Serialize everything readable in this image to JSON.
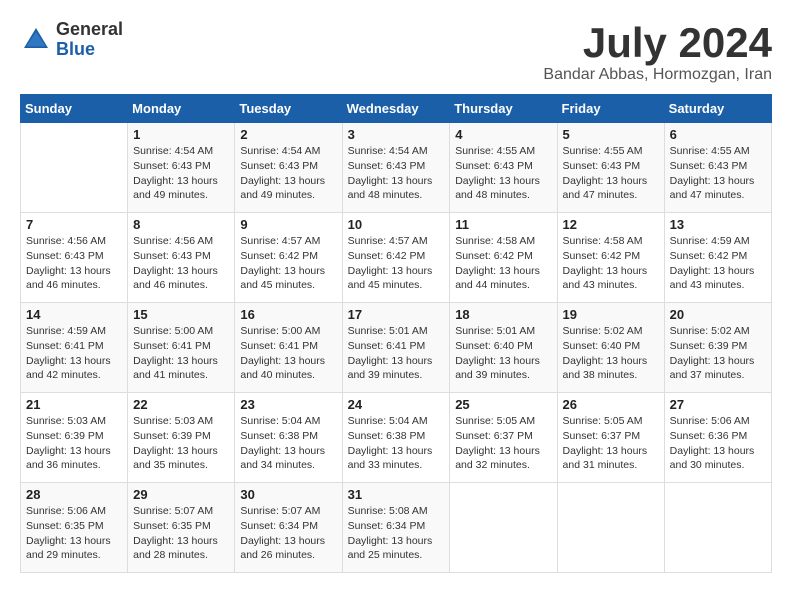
{
  "logo": {
    "general": "General",
    "blue": "Blue"
  },
  "title": "July 2024",
  "subtitle": "Bandar Abbas, Hormozgan, Iran",
  "calendar": {
    "headers": [
      "Sunday",
      "Monday",
      "Tuesday",
      "Wednesday",
      "Thursday",
      "Friday",
      "Saturday"
    ],
    "rows": [
      [
        {
          "day": "",
          "info": ""
        },
        {
          "day": "1",
          "info": "Sunrise: 4:54 AM\nSunset: 6:43 PM\nDaylight: 13 hours\nand 49 minutes."
        },
        {
          "day": "2",
          "info": "Sunrise: 4:54 AM\nSunset: 6:43 PM\nDaylight: 13 hours\nand 49 minutes."
        },
        {
          "day": "3",
          "info": "Sunrise: 4:54 AM\nSunset: 6:43 PM\nDaylight: 13 hours\nand 48 minutes."
        },
        {
          "day": "4",
          "info": "Sunrise: 4:55 AM\nSunset: 6:43 PM\nDaylight: 13 hours\nand 48 minutes."
        },
        {
          "day": "5",
          "info": "Sunrise: 4:55 AM\nSunset: 6:43 PM\nDaylight: 13 hours\nand 47 minutes."
        },
        {
          "day": "6",
          "info": "Sunrise: 4:55 AM\nSunset: 6:43 PM\nDaylight: 13 hours\nand 47 minutes."
        }
      ],
      [
        {
          "day": "7",
          "info": "Sunrise: 4:56 AM\nSunset: 6:43 PM\nDaylight: 13 hours\nand 46 minutes."
        },
        {
          "day": "8",
          "info": "Sunrise: 4:56 AM\nSunset: 6:43 PM\nDaylight: 13 hours\nand 46 minutes."
        },
        {
          "day": "9",
          "info": "Sunrise: 4:57 AM\nSunset: 6:42 PM\nDaylight: 13 hours\nand 45 minutes."
        },
        {
          "day": "10",
          "info": "Sunrise: 4:57 AM\nSunset: 6:42 PM\nDaylight: 13 hours\nand 45 minutes."
        },
        {
          "day": "11",
          "info": "Sunrise: 4:58 AM\nSunset: 6:42 PM\nDaylight: 13 hours\nand 44 minutes."
        },
        {
          "day": "12",
          "info": "Sunrise: 4:58 AM\nSunset: 6:42 PM\nDaylight: 13 hours\nand 43 minutes."
        },
        {
          "day": "13",
          "info": "Sunrise: 4:59 AM\nSunset: 6:42 PM\nDaylight: 13 hours\nand 43 minutes."
        }
      ],
      [
        {
          "day": "14",
          "info": "Sunrise: 4:59 AM\nSunset: 6:41 PM\nDaylight: 13 hours\nand 42 minutes."
        },
        {
          "day": "15",
          "info": "Sunrise: 5:00 AM\nSunset: 6:41 PM\nDaylight: 13 hours\nand 41 minutes."
        },
        {
          "day": "16",
          "info": "Sunrise: 5:00 AM\nSunset: 6:41 PM\nDaylight: 13 hours\nand 40 minutes."
        },
        {
          "day": "17",
          "info": "Sunrise: 5:01 AM\nSunset: 6:41 PM\nDaylight: 13 hours\nand 39 minutes."
        },
        {
          "day": "18",
          "info": "Sunrise: 5:01 AM\nSunset: 6:40 PM\nDaylight: 13 hours\nand 39 minutes."
        },
        {
          "day": "19",
          "info": "Sunrise: 5:02 AM\nSunset: 6:40 PM\nDaylight: 13 hours\nand 38 minutes."
        },
        {
          "day": "20",
          "info": "Sunrise: 5:02 AM\nSunset: 6:39 PM\nDaylight: 13 hours\nand 37 minutes."
        }
      ],
      [
        {
          "day": "21",
          "info": "Sunrise: 5:03 AM\nSunset: 6:39 PM\nDaylight: 13 hours\nand 36 minutes."
        },
        {
          "day": "22",
          "info": "Sunrise: 5:03 AM\nSunset: 6:39 PM\nDaylight: 13 hours\nand 35 minutes."
        },
        {
          "day": "23",
          "info": "Sunrise: 5:04 AM\nSunset: 6:38 PM\nDaylight: 13 hours\nand 34 minutes."
        },
        {
          "day": "24",
          "info": "Sunrise: 5:04 AM\nSunset: 6:38 PM\nDaylight: 13 hours\nand 33 minutes."
        },
        {
          "day": "25",
          "info": "Sunrise: 5:05 AM\nSunset: 6:37 PM\nDaylight: 13 hours\nand 32 minutes."
        },
        {
          "day": "26",
          "info": "Sunrise: 5:05 AM\nSunset: 6:37 PM\nDaylight: 13 hours\nand 31 minutes."
        },
        {
          "day": "27",
          "info": "Sunrise: 5:06 AM\nSunset: 6:36 PM\nDaylight: 13 hours\nand 30 minutes."
        }
      ],
      [
        {
          "day": "28",
          "info": "Sunrise: 5:06 AM\nSunset: 6:35 PM\nDaylight: 13 hours\nand 29 minutes."
        },
        {
          "day": "29",
          "info": "Sunrise: 5:07 AM\nSunset: 6:35 PM\nDaylight: 13 hours\nand 28 minutes."
        },
        {
          "day": "30",
          "info": "Sunrise: 5:07 AM\nSunset: 6:34 PM\nDaylight: 13 hours\nand 26 minutes."
        },
        {
          "day": "31",
          "info": "Sunrise: 5:08 AM\nSunset: 6:34 PM\nDaylight: 13 hours\nand 25 minutes."
        },
        {
          "day": "",
          "info": ""
        },
        {
          "day": "",
          "info": ""
        },
        {
          "day": "",
          "info": ""
        }
      ]
    ]
  }
}
